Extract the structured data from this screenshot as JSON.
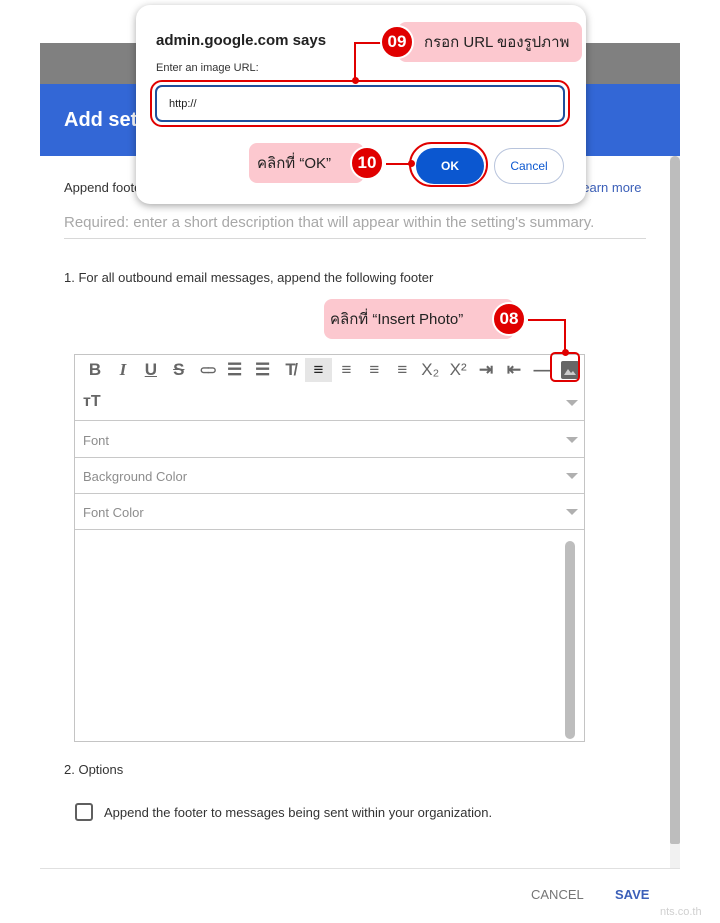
{
  "page": {
    "header_title": "Add setting",
    "append_label": "Append footer",
    "learn_more": "Learn more",
    "description_placeholder": "Required: enter a short description that will appear within the setting's summary.",
    "section1_label": "1. For all outbound email messages, append the following footer",
    "section2_label": "2. Options",
    "checkbox_label": "Append the footer to messages being sent within your organization.",
    "checkbox_checked": false,
    "cancel_label": "CANCEL",
    "save_label": "SAVE",
    "watermark": "nts.co.th"
  },
  "editor": {
    "toolbar": [
      {
        "name": "bold",
        "glyph": "B"
      },
      {
        "name": "italic",
        "glyph": "I"
      },
      {
        "name": "underline",
        "glyph": "U"
      },
      {
        "name": "strikethrough",
        "glyph": "S"
      },
      {
        "name": "link",
        "glyph": "⊂⊃"
      },
      {
        "name": "numbered-list",
        "glyph": "☰"
      },
      {
        "name": "bulleted-list",
        "glyph": "☰"
      },
      {
        "name": "clear-formatting",
        "glyph": "T̸"
      },
      {
        "name": "align-left",
        "glyph": "≡",
        "active": true
      },
      {
        "name": "align-center",
        "glyph": "≡"
      },
      {
        "name": "align-right",
        "glyph": "≡"
      },
      {
        "name": "justify",
        "glyph": "≡"
      },
      {
        "name": "subscript",
        "glyph": "X₂"
      },
      {
        "name": "superscript",
        "glyph": "X²"
      },
      {
        "name": "indent",
        "glyph": "⇥"
      },
      {
        "name": "outdent",
        "glyph": "⇤"
      },
      {
        "name": "horizontal-rule",
        "glyph": "—"
      },
      {
        "name": "insert-photo",
        "glyph": "▲"
      }
    ],
    "font_size_glyph": "тT",
    "font_label": "Font",
    "background_color_label": "Background Color",
    "font_color_label": "Font Color",
    "body": ""
  },
  "dialog": {
    "title": "admin.google.com says",
    "prompt": "Enter an image URL:",
    "input_value": "http://",
    "ok_label": "OK",
    "cancel_label": "Cancel"
  },
  "annotations": {
    "step08": {
      "number": "08",
      "text": "คลิกที่ “Insert Photo”"
    },
    "step09": {
      "number": "09",
      "text": "กรอก URL ของรูปภาพ"
    },
    "step10": {
      "number": "10",
      "text": "คลิกที่ “OK”"
    }
  },
  "colors": {
    "header": "#3367d6",
    "primary_button": "#0b57d0",
    "annotation_red": "#e00000",
    "annotation_pink": "#fcc8cf"
  }
}
